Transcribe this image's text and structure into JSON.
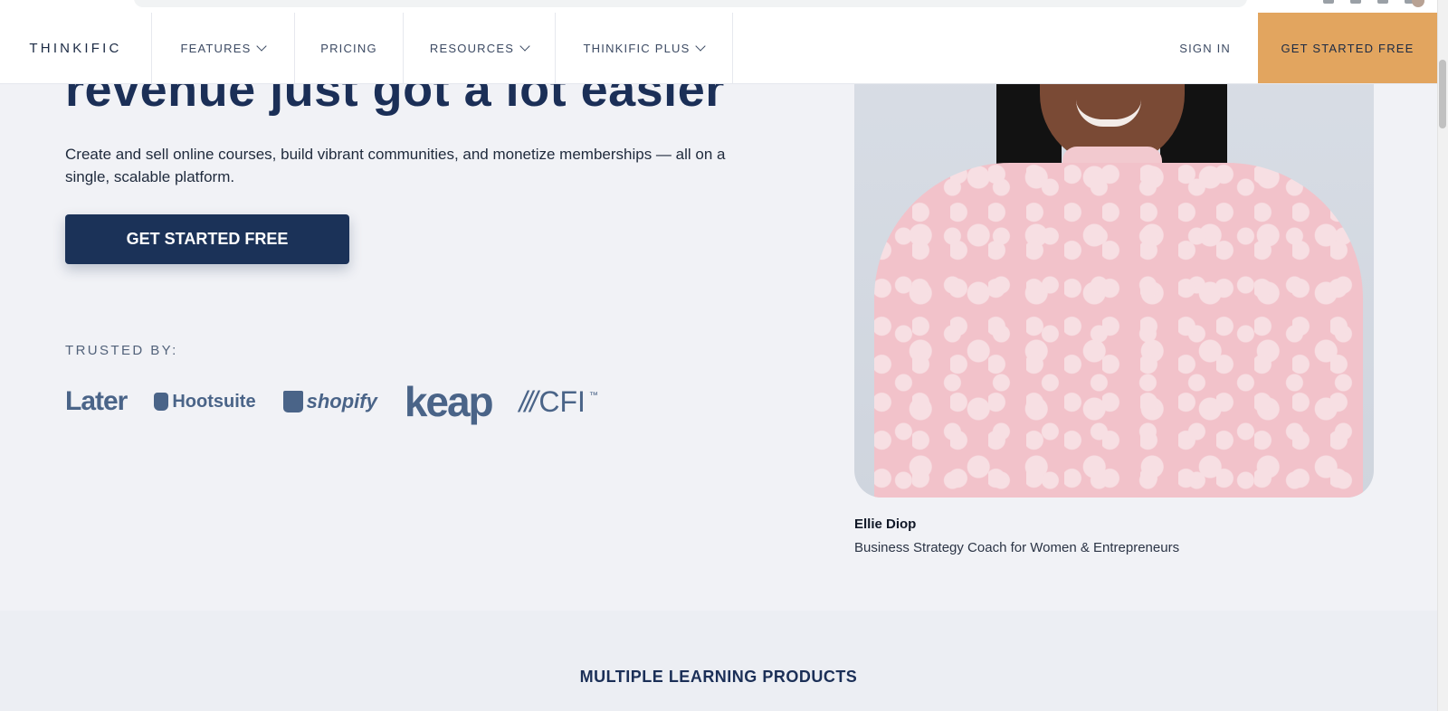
{
  "nav": {
    "logo": "THINKIFIC",
    "features": "FEATURES",
    "pricing": "PRICING",
    "resources": "RESOURCES",
    "thinkific_plus": "THINKIFIC PLUS",
    "sign_in": "SIGN IN",
    "cta": "GET STARTED FREE"
  },
  "hero": {
    "headline": "revenue just got a lot easier",
    "subtext": "Create and sell online courses, build vibrant communities, and monetize memberships — all on a single, scalable platform.",
    "cta": "GET STARTED FREE",
    "trusted_label": "TRUSTED BY:",
    "logos": [
      "Later",
      "Hootsuite",
      "shopify",
      "keap",
      "CFI"
    ]
  },
  "testimonial": {
    "name": "Ellie Diop",
    "role": "Business Strategy Coach for Women & Entrepreneurs"
  },
  "next_section": {
    "heading": "MULTIPLE LEARNING PRODUCTS"
  },
  "colors": {
    "brand_navy": "#1b2f57",
    "cta_orange": "#e2a55f",
    "page_bg": "#f1f2f6"
  }
}
